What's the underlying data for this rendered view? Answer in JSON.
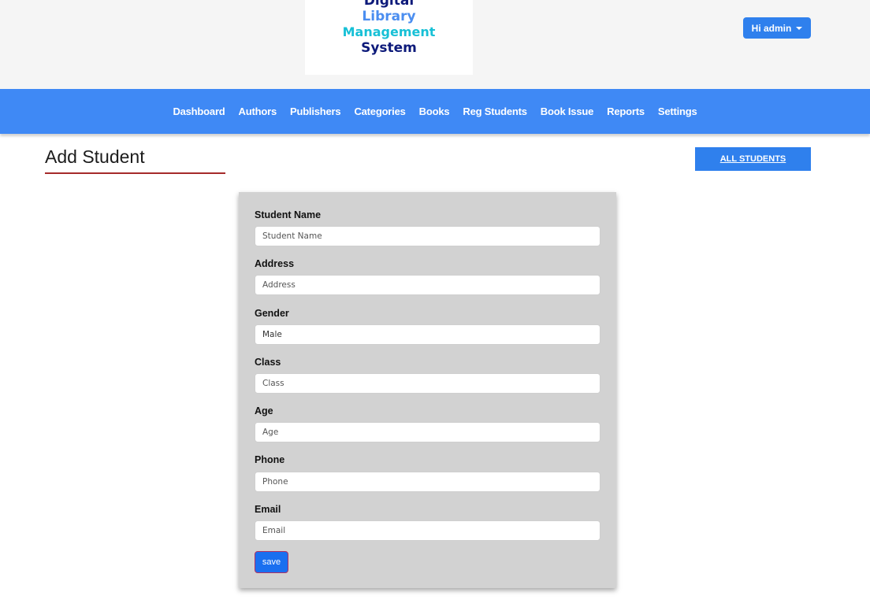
{
  "header": {
    "logo_lines": [
      "Digital",
      "Library",
      "Management",
      "System"
    ],
    "user_menu_label": "Hi admin"
  },
  "nav": {
    "items": [
      {
        "label": "Dashboard"
      },
      {
        "label": "Authors"
      },
      {
        "label": "Publishers"
      },
      {
        "label": "Categories"
      },
      {
        "label": "Books"
      },
      {
        "label": "Reg Students"
      },
      {
        "label": "Book Issue"
      },
      {
        "label": "Reports"
      },
      {
        "label": "Settings"
      }
    ]
  },
  "page": {
    "title": "Add Student",
    "all_students_label": "ALL STUDENTS"
  },
  "form": {
    "fields": [
      {
        "label": "Student Name",
        "placeholder": "Student Name",
        "value": ""
      },
      {
        "label": "Address",
        "placeholder": "Address",
        "value": ""
      },
      {
        "label": "Gender",
        "placeholder": "",
        "value": "Male"
      },
      {
        "label": "Class",
        "placeholder": "Class",
        "value": ""
      },
      {
        "label": "Age",
        "placeholder": "Age",
        "value": ""
      },
      {
        "label": "Phone",
        "placeholder": "Phone",
        "value": ""
      },
      {
        "label": "Email",
        "placeholder": "Email",
        "value": ""
      }
    ],
    "save_label": "save"
  },
  "colors": {
    "nav_background": "#3f89f5",
    "primary_button": "#2f80ed",
    "title_underline": "#a52a2a",
    "form_background": "#d2d2d2"
  }
}
